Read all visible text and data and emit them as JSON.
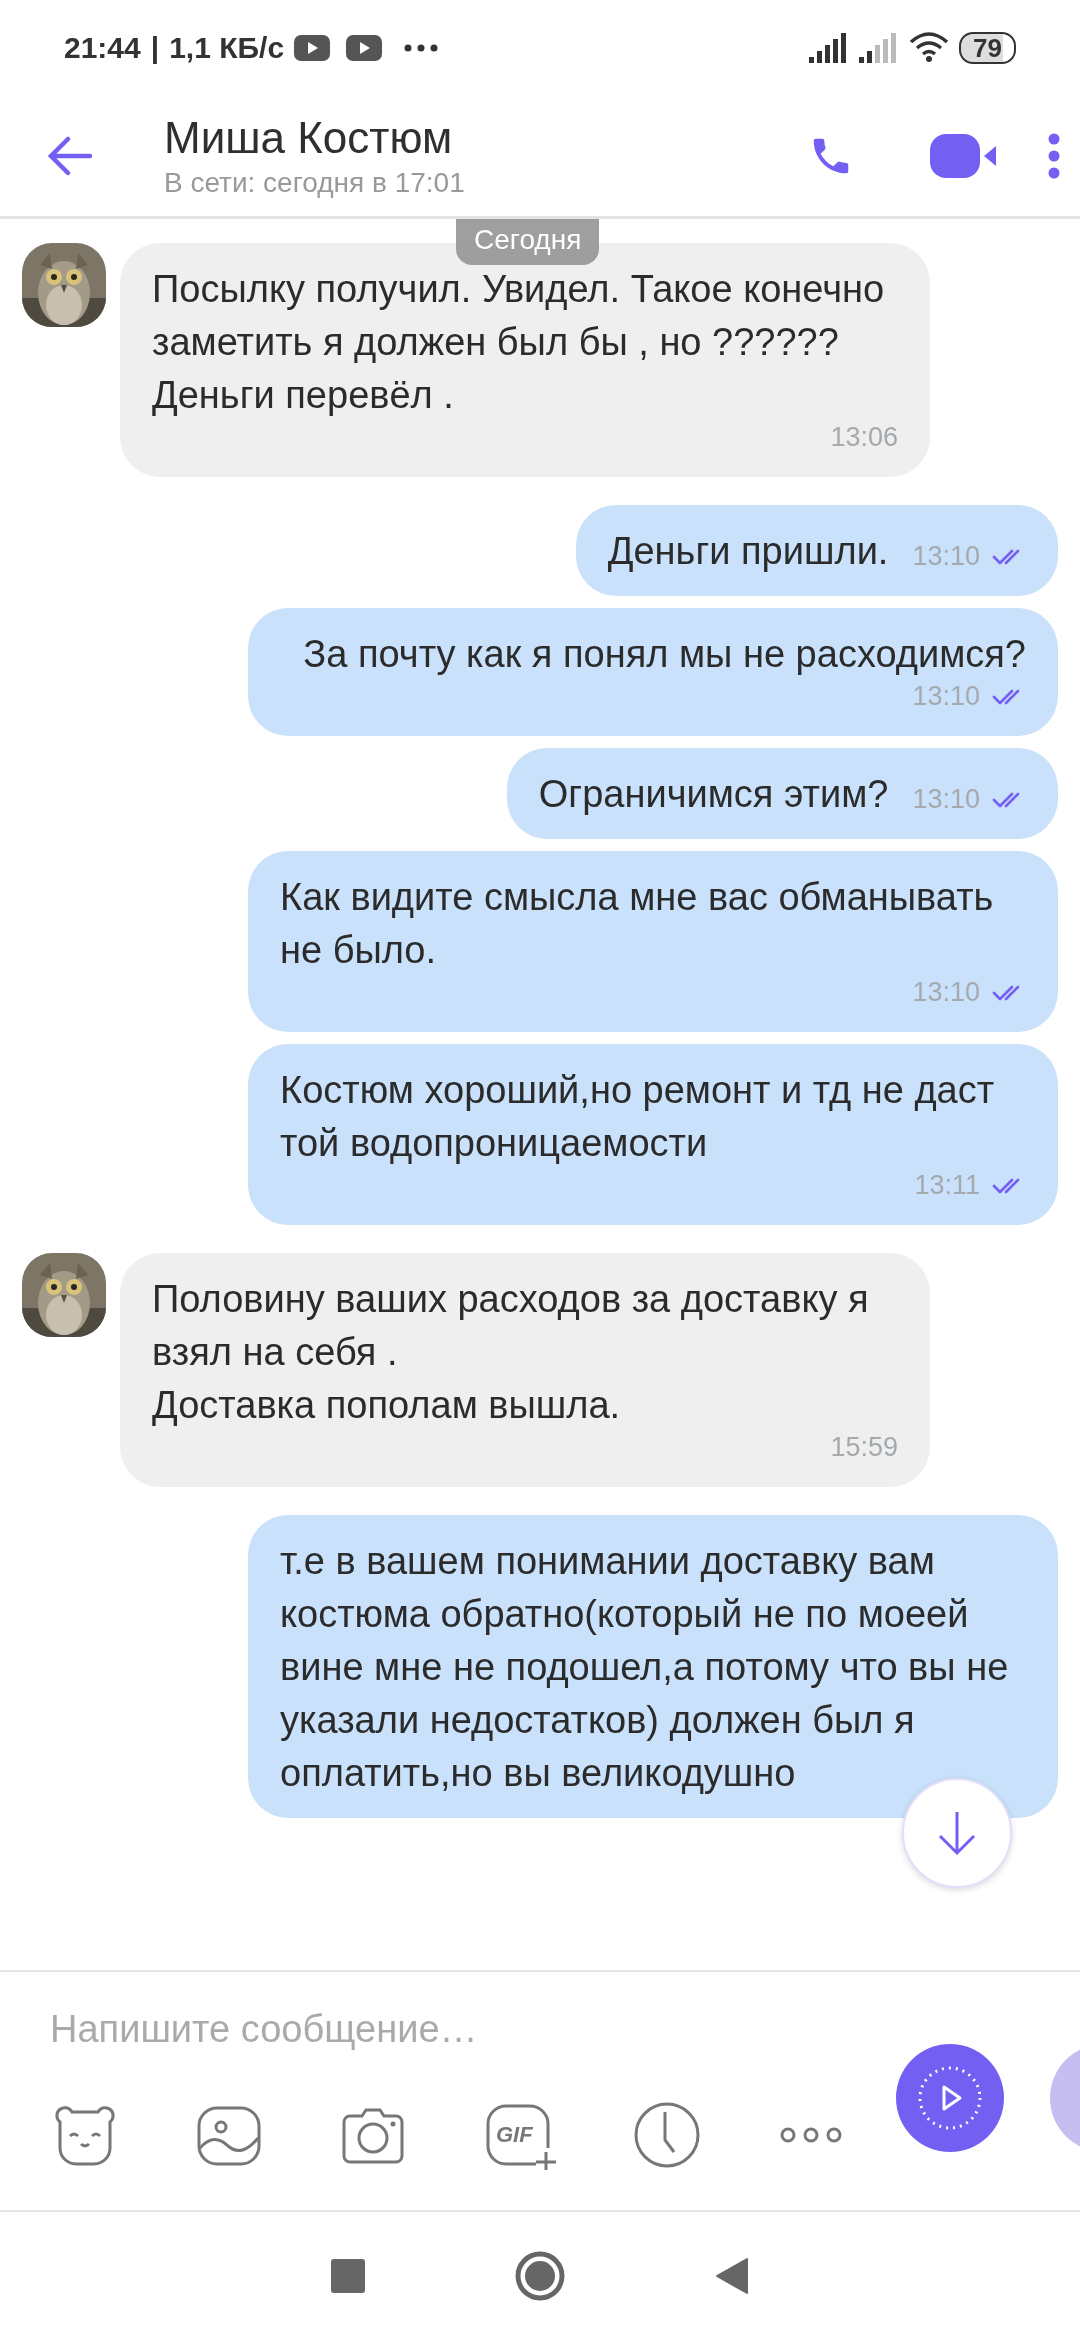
{
  "status_bar": {
    "time": "21:44",
    "separator": "|",
    "speed": "1,1 КБ/с",
    "battery": "79"
  },
  "header": {
    "title": "Миша Костюм",
    "subtitle": "В сети: сегодня в 17:01"
  },
  "date_chip": "Сегодня",
  "messages": [
    {
      "kind": "incoming",
      "text": "Посылку получил. Увидел. Такое конечно заметить я должен был бы , но ??????\nДеньги перевёл .",
      "time": "13:06"
    },
    {
      "kind": "outgoing",
      "text": "Деньги пришли.",
      "time": "13:10"
    },
    {
      "kind": "outgoing",
      "text": "За почту как я понял мы не расходимся?",
      "time": "13:10"
    },
    {
      "kind": "outgoing",
      "text": "Ограничимся этим?",
      "time": "13:10"
    },
    {
      "kind": "outgoing",
      "text": "Как видите смысла мне вас обманывать не было.",
      "time": "13:10"
    },
    {
      "kind": "outgoing",
      "text": "Костюм хороший,но ремонт и тд не даст той водопроницаемости",
      "time": "13:11"
    },
    {
      "kind": "incoming",
      "text": "Половину ваших расходов за доставку я взял на себя .\nДоставка пополам вышла.",
      "time": "15:59"
    },
    {
      "kind": "outgoing",
      "text": "т.е в вашем понимании доставку вам костюма обратно(который не по моеей вине мне не подошел,а потому что вы не указали недостатков) должен был я оплатить,но вы великодушно"
    }
  ],
  "composer": {
    "placeholder": "Напишите сообщение…",
    "gif_label": "GIF"
  }
}
